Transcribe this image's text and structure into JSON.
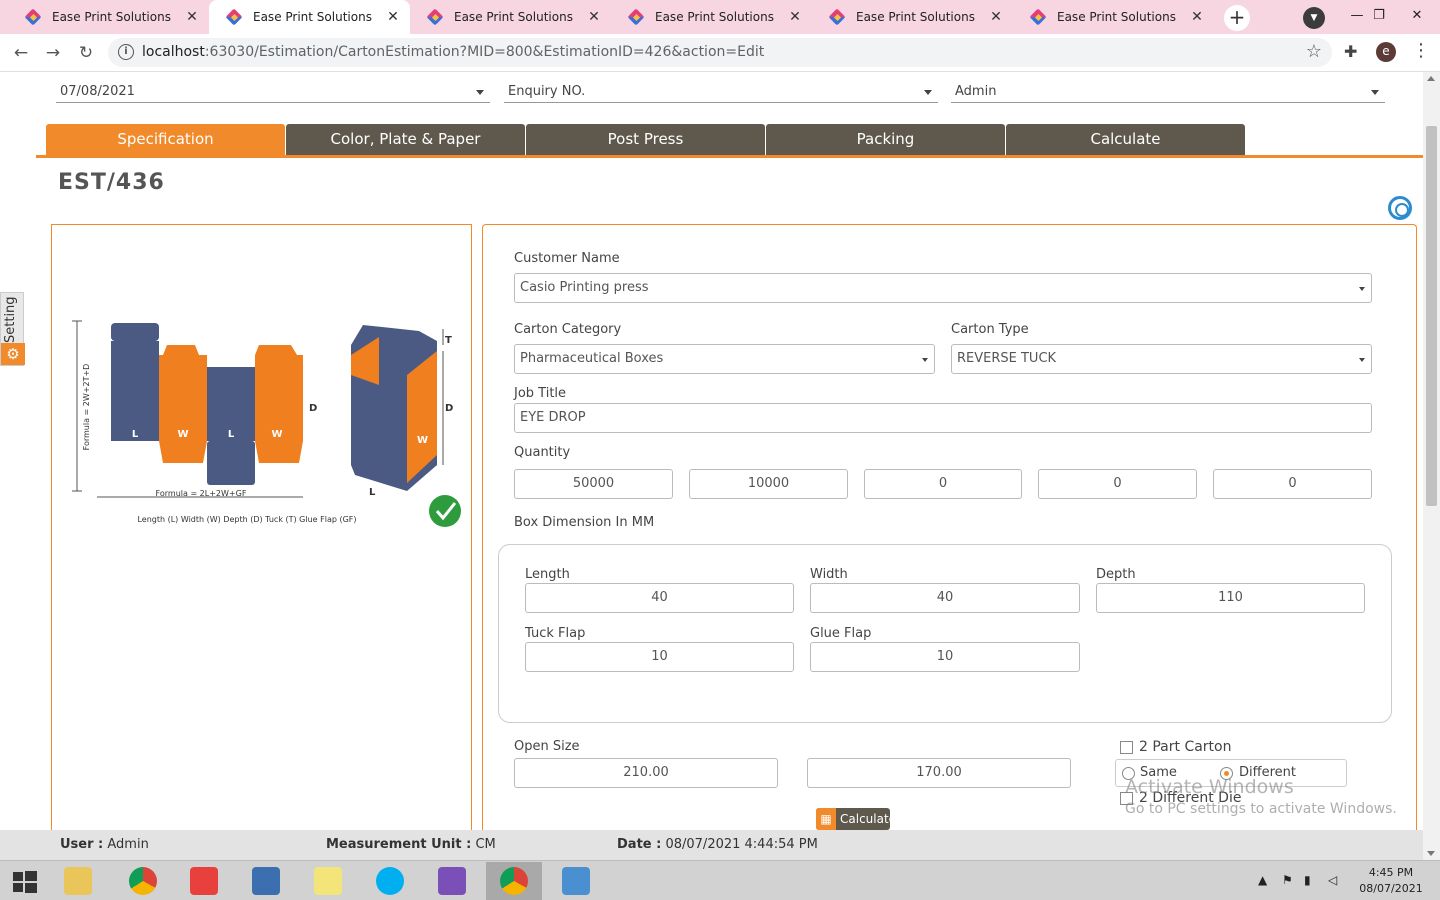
{
  "browser": {
    "tabs": [
      {
        "title": "Ease Print Solutions",
        "active": false
      },
      {
        "title": "Ease Print Solutions",
        "active": true
      },
      {
        "title": "Ease Print Solutions",
        "active": false
      },
      {
        "title": "Ease Print Solutions",
        "active": false
      },
      {
        "title": "Ease Print Solutions",
        "active": false
      },
      {
        "title": "Ease Print Solutions",
        "active": false
      }
    ],
    "url_host": "localhost",
    "url_path": ":63030/Estimation/CartonEstimation?MID=800&EstimationID=426&action=Edit",
    "avatar_letter": "e"
  },
  "header_fields": {
    "date": "07/08/2021",
    "enquiry_placeholder": "Enquiry NO.",
    "user": "Admin"
  },
  "page_tabs": [
    {
      "label": "Specification",
      "active": true
    },
    {
      "label": "Color, Plate & Paper",
      "active": false
    },
    {
      "label": "Post Press",
      "active": false
    },
    {
      "label": "Packing",
      "active": false
    },
    {
      "label": "Calculate",
      "active": false
    }
  ],
  "estimate_id": "EST/436",
  "side_setting_label": "Setting",
  "diagram": {
    "formula_vertical": "Formula = 2W+2T+D",
    "formula_horizontal": "Formula = 2L+2W+GF",
    "legend": "Length (L)  Width (W)  Depth (D)  Tuck (T)  Glue Flap (GF)",
    "labels": [
      "L",
      "W",
      "L",
      "W",
      "D",
      "T",
      "D",
      "W",
      "L"
    ]
  },
  "form": {
    "customer_name_label": "Customer Name",
    "customer_name": "Casio Printing press",
    "carton_category_label": "Carton Category",
    "carton_category": "Pharmaceutical Boxes",
    "carton_type_label": "Carton Type",
    "carton_type": "REVERSE TUCK",
    "job_title_label": "Job Title",
    "job_title": "EYE DROP",
    "quantity_label": "Quantity",
    "quantities": [
      "50000",
      "10000",
      "0",
      "0",
      "0"
    ],
    "box_dimension_label": "Box Dimension In MM",
    "length_label": "Length",
    "length": "40",
    "width_label": "Width",
    "width": "40",
    "depth_label": "Depth",
    "depth": "110",
    "tuck_flap_label": "Tuck Flap",
    "tuck_flap": "10",
    "glue_flap_label": "Glue Flap",
    "glue_flap": "10",
    "open_size_label": "Open Size",
    "open_size_1": "210.00",
    "open_size_2": "170.00",
    "calculate_label": "Calculate",
    "two_part_carton_label": "2 Part Carton",
    "same_label": "Same",
    "different_label": "Different",
    "two_different_die_label": "2 Different Die"
  },
  "watermark": {
    "line1": "Activate Windows",
    "line2": "Go to PC settings to activate Windows."
  },
  "statusbar": {
    "user_label": "User :",
    "user_value": "Admin",
    "unit_label": "Measurement Unit :",
    "unit_value": "CM",
    "date_label": "Date :",
    "date_value": "08/07/2021 4:44:54 PM"
  },
  "taskbar": {
    "time": "4:45 PM",
    "date": "08/07/2021"
  },
  "colors": {
    "accent": "#f18a2a",
    "tab_inactive": "#5f594d",
    "carton_blue": "#4a5a82",
    "carton_orange": "#f07f1f"
  }
}
